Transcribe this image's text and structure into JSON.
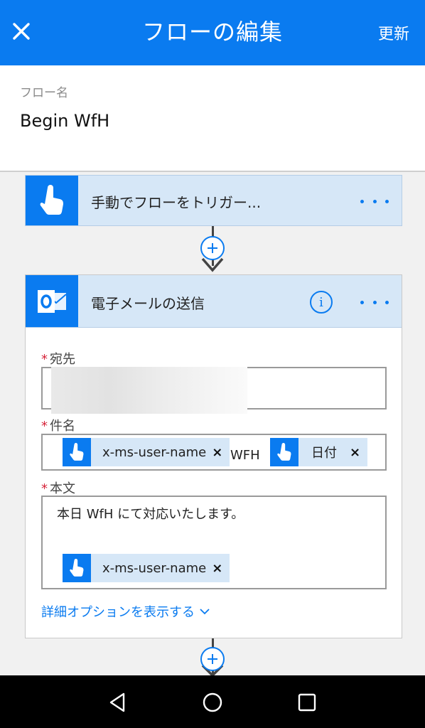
{
  "header": {
    "title": "フローの編集",
    "update_label": "更新",
    "close_icon": "close-icon"
  },
  "flow_name": {
    "label": "フロー名",
    "value": "Begin WfH"
  },
  "trigger": {
    "title": "手動でフローをトリガー...",
    "icon": "touch-hand-icon"
  },
  "action": {
    "title": "電子メールの送信",
    "icon": "outlook-icon",
    "to": {
      "label": "宛先",
      "required": "*"
    },
    "subject": {
      "label": "件名",
      "required": "*",
      "token1": "x-ms-user-name",
      "remove1": "×",
      "text": "WFH",
      "token2": "日付",
      "remove2": "×"
    },
    "body": {
      "label": "本文",
      "required": "*",
      "text": "本日 WfH にて対応いたします。",
      "token": "x-ms-user-name",
      "remove": "×"
    },
    "advanced_options": "詳細オプションを表示する"
  },
  "colors": {
    "accent": "#0a7bf0",
    "card_header": "#d6e7f7",
    "required": "#d6243a"
  }
}
